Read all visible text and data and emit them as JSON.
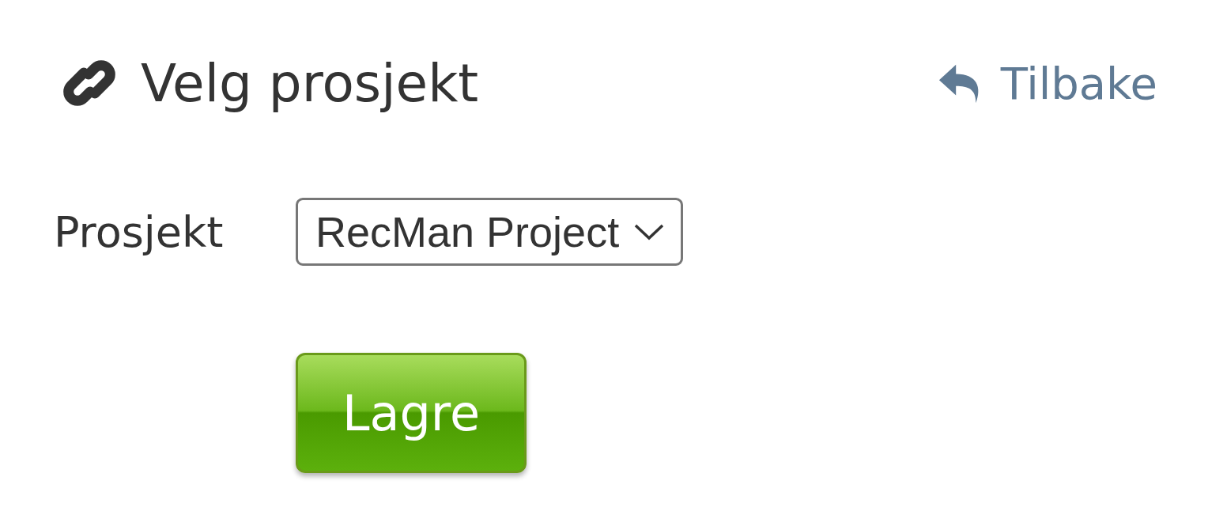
{
  "header": {
    "title": "Velg prosjekt",
    "back_link": "Tilbake"
  },
  "field": {
    "label": "Prosjekt",
    "value": "RecMan Project"
  },
  "save_button": "Lagre"
}
